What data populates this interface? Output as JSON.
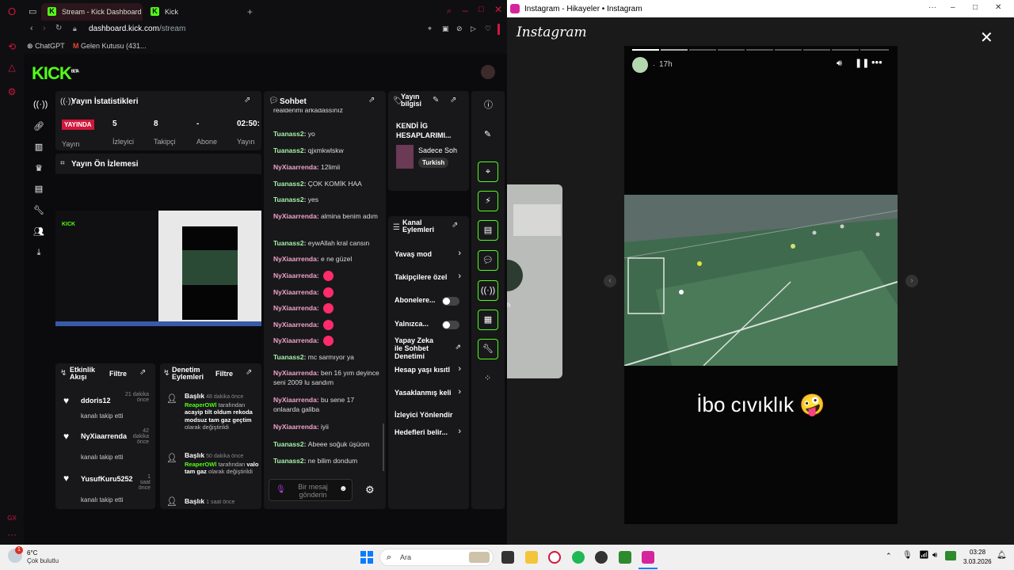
{
  "browser": {
    "tabs": [
      {
        "title": "Stream - Kick Dashboard"
      },
      {
        "title": "Kick"
      }
    ],
    "url_host": "dashboard.kick.com",
    "url_path": "/stream",
    "bookmarks": [
      "ChatGPT",
      "Gelen Kutusu (431..."
    ]
  },
  "kick": {
    "logo": "KICK",
    "logo_sup": "BETA",
    "stats_panel": {
      "title": "Yayın İstatistikleri",
      "live_badge": "YAYINDA",
      "live_label": "Yayın",
      "stats": [
        {
          "value": "5",
          "label": "İzleyici"
        },
        {
          "value": "8",
          "label": "Takipçi"
        },
        {
          "value": "-",
          "label": "Abone"
        },
        {
          "value": "02:50:",
          "label": "Yayın"
        }
      ]
    },
    "preview_panel": {
      "title": "Yayın Ön İzlemesi"
    },
    "chat_panel": {
      "title": "Sohbet",
      "messages": [
        {
          "user": "NyXiaarrenda",
          "text": "Tuana siz realdenmi arkadassınız",
          "color": "u2"
        },
        {
          "user": "Tuanass2",
          "text": "yo",
          "color": "u1"
        },
        {
          "user": "Tuanass2",
          "text": "qjxmkwlskw",
          "color": "u1"
        },
        {
          "user": "NyXiaarrenda",
          "text": "12limii",
          "color": "u2"
        },
        {
          "user": "Tuanass2",
          "text": "ÇOK KOMİK HAA",
          "color": "u1"
        },
        {
          "user": "Tuanass2",
          "text": "yes",
          "color": "u1"
        },
        {
          "user": "NyXiaarrenda",
          "text": "almina benim adım",
          "color": "u2"
        },
        {
          "user": "Tuanass2",
          "text": "eywAllah kral cansın",
          "color": "u1"
        },
        {
          "user": "NyXiaarrenda",
          "text": "e ne güzel",
          "color": "u2"
        },
        {
          "user": "NyXiaarrenda",
          "text": "",
          "color": "u2",
          "emoji": true
        },
        {
          "user": "NyXiaarrenda",
          "text": "",
          "color": "u2",
          "emoji": true
        },
        {
          "user": "NyXiaarrenda",
          "text": "",
          "color": "u2",
          "emoji": true
        },
        {
          "user": "NyXiaarrenda",
          "text": "",
          "color": "u2",
          "emoji": true
        },
        {
          "user": "NyXiaarrenda",
          "text": "",
          "color": "u2",
          "emoji": true
        },
        {
          "user": "Tuanass2",
          "text": "mc sarmıyor ya",
          "color": "u1"
        },
        {
          "user": "NyXiaarrenda",
          "text": "ben 16 yım deyince seni 2009 lu sandım",
          "color": "u2"
        },
        {
          "user": "NyXiaarrenda",
          "text": "bu sene 17 onlaarda galiba",
          "color": "u2"
        },
        {
          "user": "NyXiaarrenda",
          "text": "iyii",
          "color": "u2"
        },
        {
          "user": "Tuanass2",
          "text": "Abeee soğuk üşüom",
          "color": "u1"
        },
        {
          "user": "Tuanass2",
          "text": "ne bilim dondum",
          "color": "u1"
        }
      ],
      "input_placeholder": "Bir mesaj gönderin"
    },
    "info_panel": {
      "title": "Yayın bilgisi",
      "stream_title": "KENDİ İG HESAPLARIMI...",
      "category": "Sadece Soh",
      "tag": "Turkish"
    },
    "channel_actions": {
      "title": "Kanal Eylemleri",
      "items": [
        {
          "label": "Yavaş mod",
          "kind": "chev"
        },
        {
          "label": "Takipçilere özel",
          "kind": "chev"
        },
        {
          "label": "Abonelere...",
          "kind": "toggle"
        },
        {
          "label": "Yalnızca...",
          "kind": "toggle"
        },
        {
          "label": "Yapay Zeka ile Sohbet Denetimi",
          "kind": "ext"
        },
        {
          "label": "Hesap yaşı kısıtl",
          "kind": "chev"
        },
        {
          "label": "Yasaklanmış keli",
          "kind": "chev"
        },
        {
          "label": "İzleyici Yönlendir",
          "kind": "none"
        },
        {
          "label": "Hedefleri belir...",
          "kind": "chev"
        }
      ]
    },
    "activity_panel": {
      "title": "Etkinlik Akışı",
      "filter": "Filtre",
      "items": [
        {
          "name": "ddoris12",
          "sub": "kanalı takip etti",
          "time": "21 dakika önce"
        },
        {
          "name": "NyXiaarrenda",
          "sub": "kanalı takip etti",
          "time": "42 dakika önce"
        },
        {
          "name": "YusufKuru5252",
          "sub": "kanalı takip etti",
          "time": "1 saat önce"
        }
      ]
    },
    "moderation_panel": {
      "title": "Denetim Eylemleri",
      "filter": "Filtre",
      "items": [
        {
          "head": "Başlık",
          "time": "48 dakika önce",
          "user": "ReaperOWl",
          "pre": "tarafından",
          "text": "acayip tilt oldum rekoda modsuz tam gaz geçtim",
          "post": "olarak değiştirildi"
        },
        {
          "head": "Başlık",
          "time": "50 dakika önce",
          "user": "ReaperOWl",
          "pre": "tarafından",
          "text": "valo tam gaz",
          "post": "olarak değiştirildi"
        },
        {
          "head": "Başlık",
          "time": "1 saat önce"
        }
      ]
    }
  },
  "instagram": {
    "window_title": "Instagram - Hikayeler • Instagram",
    "logo": "Instagram",
    "story_time": "17h",
    "caption": "İbo cıvıklık 🤪",
    "side_caption": "h"
  },
  "taskbar": {
    "weather_temp": "6°C",
    "weather_desc": "Çok bulutlu",
    "search": "Ara",
    "time": "03:28",
    "date": "3.03.2026"
  }
}
